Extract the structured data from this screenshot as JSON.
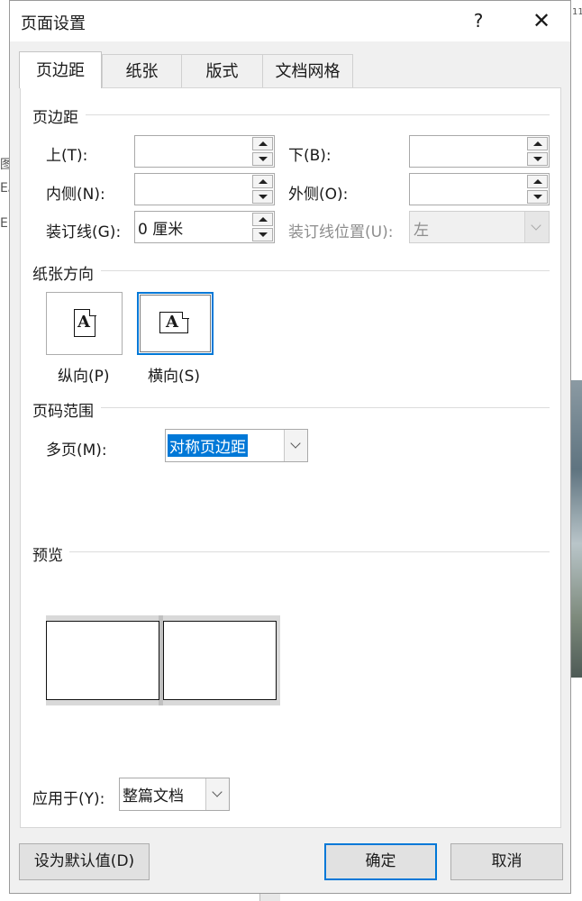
{
  "background": {
    "edge_text": [
      "图",
      "E。",
      "E"
    ],
    "top_right_mark": "11"
  },
  "dialog": {
    "title": "页面设置",
    "help_label": "?",
    "close_label": "✕",
    "tabs": [
      {
        "label": "页边距",
        "active": true
      },
      {
        "label": "纸张",
        "active": false
      },
      {
        "label": "版式",
        "active": false
      },
      {
        "label": "文档网格",
        "active": false
      }
    ]
  },
  "margins": {
    "section_title": "页边距",
    "top": {
      "label": "上(T):",
      "value": ""
    },
    "bottom": {
      "label": "下(B):",
      "value": ""
    },
    "inside": {
      "label": "内侧(N):",
      "value": ""
    },
    "outside": {
      "label": "外侧(O):",
      "value": ""
    },
    "gutter": {
      "label": "装订线(G):",
      "value": "0 厘米"
    },
    "gutter_position": {
      "label": "装订线位置(U):",
      "value": "左",
      "disabled": true
    }
  },
  "orientation": {
    "section_title": "纸张方向",
    "portrait_label": "纵向(P)",
    "landscape_label": "横向(S)",
    "selected": "landscape",
    "icon_letter": "A"
  },
  "pages": {
    "section_title": "页码范围",
    "multiple_label": "多页(M):",
    "multiple_value": "对称页边距"
  },
  "preview": {
    "section_title": "预览"
  },
  "apply": {
    "label": "应用于(Y):",
    "value": "整篇文档"
  },
  "buttons": {
    "set_default": "设为默认值(D)",
    "ok": "确定",
    "cancel": "取消"
  },
  "colors": {
    "accent": "#0078d7",
    "dialog_bg": "#f0f0f0"
  }
}
